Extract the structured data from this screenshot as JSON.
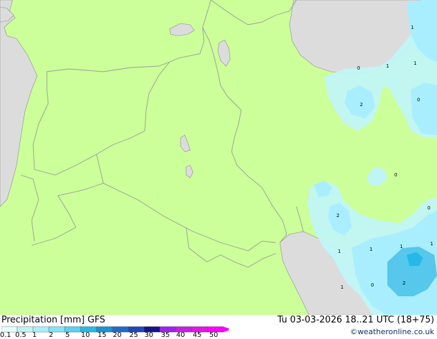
{
  "footer": {
    "title": "Precipitation [mm] GFS",
    "valid_time": "Tu 03-03-2026 18..21 UTC (18+75)",
    "copyright": "©weatheronline.co.uk"
  },
  "legend": {
    "ticks": [
      "0.1",
      "0.5",
      "1",
      "2",
      "5",
      "10",
      "15",
      "20",
      "25",
      "30",
      "35",
      "40",
      "45",
      "50"
    ],
    "colors": [
      "#e6ffff",
      "#c0f5f5",
      "#a8eeff",
      "#7fe6f5",
      "#55d3f0",
      "#26b9e8",
      "#1993d4",
      "#1f6cc7",
      "#2347b8",
      "#14148c",
      "#a020f0",
      "#c81ee6",
      "#e614e6",
      "#ff00ff"
    ]
  },
  "map": {
    "colors": {
      "land": "#ccff99",
      "sea": "#dcdcdc",
      "precip_light": "#c0f5f5",
      "precip_mid": "#a8eeff",
      "precip_heavy": "#55c8ec",
      "border": "#9a9a9a"
    },
    "contour_labels": [
      "1",
      "1",
      "0",
      "1",
      "2",
      "0",
      "0",
      "0",
      "2",
      "1",
      "1",
      "1",
      "1",
      "1",
      "0",
      "2"
    ]
  }
}
